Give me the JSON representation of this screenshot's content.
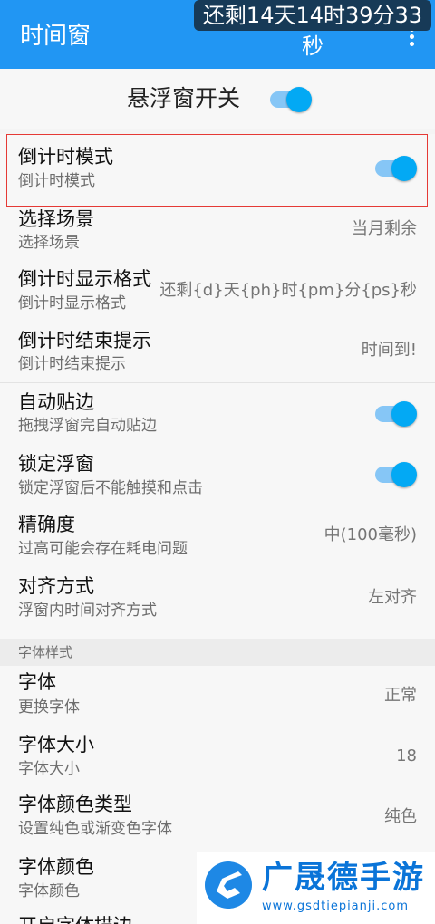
{
  "appbar": {
    "title": "时间窗",
    "overflow_icon": "more-vert-icon"
  },
  "float_timer": {
    "text": "还剩14天14时39分33秒"
  },
  "master_switch": {
    "label": "悬浮窗开关",
    "on": true
  },
  "settings": [
    {
      "title": "倒计时模式",
      "subtitle": "倒计时模式",
      "switch": true
    },
    {
      "title": "选择场景",
      "subtitle": "选择场景",
      "value": "当月剩余"
    },
    {
      "title": "倒计时显示格式",
      "subtitle": "倒计时显示格式",
      "value": "还剩{d}天{ph}时{pm}分{ps}秒"
    },
    {
      "title": "倒计时结束提示",
      "subtitle": "倒计时结束提示",
      "value": "时间到!"
    },
    {
      "title": "自动贴边",
      "subtitle": "拖拽浮窗完自动贴边",
      "switch": true
    },
    {
      "title": "锁定浮窗",
      "subtitle": "锁定浮窗后不能触摸和点击",
      "switch": true
    },
    {
      "title": "精确度",
      "subtitle": "过高可能会存在耗电问题",
      "value": "中(100毫秒)"
    },
    {
      "title": "对齐方式",
      "subtitle": "浮窗内时间对齐方式",
      "value": "左对齐"
    }
  ],
  "font_section": {
    "header": "字体样式",
    "items": [
      {
        "title": "字体",
        "subtitle": "更换字体",
        "value": "正常"
      },
      {
        "title": "字体大小",
        "subtitle": "字体大小",
        "value": "18"
      },
      {
        "title": "字体颜色类型",
        "subtitle": "设置纯色或渐变色字体",
        "value": "纯色"
      },
      {
        "title": "字体颜色",
        "subtitle": "字体颜色"
      },
      {
        "title": "开启字体描边"
      }
    ]
  },
  "watermark": {
    "name": "广晟德手游",
    "url": "www.gsdtiepianji.com"
  },
  "colors": {
    "appbar": "#2196f3",
    "switch_on": "#03a9f4",
    "highlight": "#e53935"
  }
}
